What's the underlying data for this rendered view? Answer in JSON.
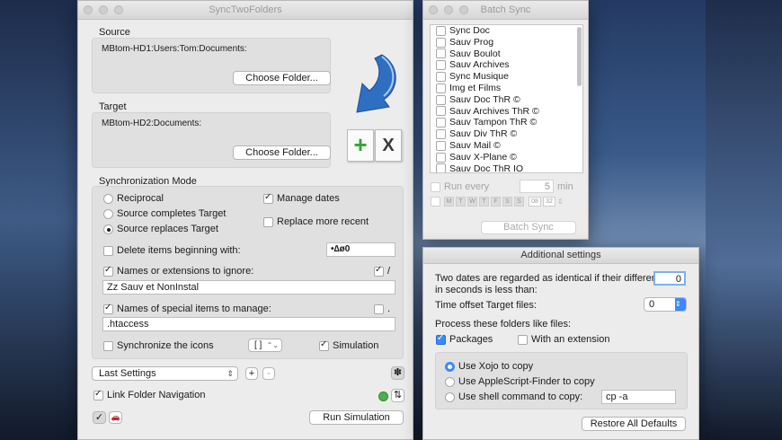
{
  "main": {
    "title": "SyncTwoFolders",
    "source_label": "Source",
    "source_path": "MBtom-HD1:Users:Tom:Documents:",
    "choose_folder_label": "Choose Folder...",
    "target_label": "Target",
    "target_path": "MBtom-HD2:Documents:",
    "sync_mode_label": "Synchronization Mode",
    "mode_reciprocal": "Reciprocal",
    "mode_completes": "Source completes Target",
    "mode_replaces": "Source replaces Target",
    "manage_dates": "Manage dates",
    "replace_recent": "Replace more recent",
    "delete_beginning": "Delete items beginning with:",
    "delete_prefix_value": "•∆ø0",
    "names_ignore": "Names or extensions to ignore:",
    "ignore_slash": "/",
    "ignore_value": "Zz Sauv et NonInstal",
    "special_items": "Names of special items to manage:",
    "special_dot": ".",
    "special_value": ".htaccess",
    "sync_icons": "Synchronize the icons",
    "icons_bracket": "[ ]",
    "simulation": "Simulation",
    "last_settings": "Last Settings",
    "plus": "+",
    "minus": "-",
    "link_nav": "Link Folder Navigation",
    "run_simulation": "Run Simulation",
    "gear_glyph": "✽",
    "swap_glyph": "⇅",
    "plus_icon_glyph": "+",
    "x_icon_glyph": "X",
    "check_glyph": "✓",
    "car_glyph": "🚗"
  },
  "batch": {
    "title": "Batch Sync",
    "items": [
      "Sync Doc",
      "Sauv Prog",
      "Sauv Boulot",
      "Sauv Archives",
      "Sync Musique",
      "Img et Films",
      "Sauv Doc ThR ©",
      "Sauv Archives ThR ©",
      "Sauv Tampon ThR ©",
      "Sauv Div ThR ©",
      "Sauv Mail ©",
      "Sauv X-Plane ©",
      "Sauv Doc ThR IO"
    ],
    "run_every": "Run every",
    "run_value": "5",
    "min": "min",
    "days": [
      "M",
      "T",
      "W",
      "T",
      "F",
      "S",
      "S"
    ],
    "hour": "08",
    "minute": "32",
    "batch_button": "Batch Sync"
  },
  "settings": {
    "title": "Additional settings",
    "identical_text_1": "Two dates are regarded as identical if their difference",
    "identical_text_2": "in seconds is less than:",
    "identical_value": "0",
    "offset_label": "Time offset Target files:",
    "offset_value": "0",
    "process_label": "Process these folders like files:",
    "packages": "Packages",
    "with_extension": "With an extension",
    "use_xojo": "Use Xojo to copy",
    "use_applescript": "Use AppleScript-Finder to copy",
    "use_shell": "Use shell command to copy:",
    "shell_value": "cp -a",
    "restore": "Restore All Defaults"
  },
  "colors": {
    "accent": "#3d8af7",
    "status_green": "#4caf50",
    "arrow_blue": "#2f6fc2"
  }
}
